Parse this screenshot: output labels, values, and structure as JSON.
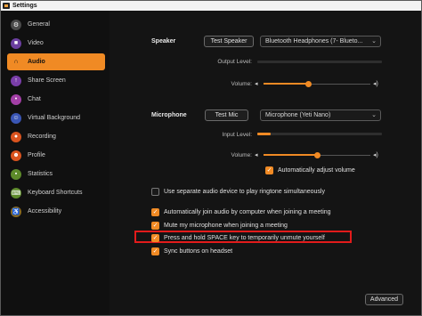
{
  "window": {
    "title": "Settings"
  },
  "sidebar": {
    "items": [
      {
        "label": "General",
        "icon": "gear-icon",
        "color": "#4a4a4a"
      },
      {
        "label": "Video",
        "icon": "camera-icon",
        "color": "#6b3fa0"
      },
      {
        "label": "Audio",
        "icon": "headphones-icon",
        "color": "#f08a24",
        "active": true
      },
      {
        "label": "Share Screen",
        "icon": "share-screen-icon",
        "color": "#7a3ea8"
      },
      {
        "label": "Chat",
        "icon": "chat-icon",
        "color": "#a33fa6"
      },
      {
        "label": "Virtual Background",
        "icon": "person-icon",
        "color": "#3a56b5"
      },
      {
        "label": "Recording",
        "icon": "record-icon",
        "color": "#d9531e"
      },
      {
        "label": "Profile",
        "icon": "profile-icon",
        "color": "#d9531e"
      },
      {
        "label": "Statistics",
        "icon": "statistics-icon",
        "color": "#5d8a2a"
      },
      {
        "label": "Keyboard Shortcuts",
        "icon": "keyboard-icon",
        "color": "#5d8a2a"
      },
      {
        "label": "Accessibility",
        "icon": "accessibility-icon",
        "color": "#8a6a20"
      }
    ]
  },
  "audio": {
    "speaker": {
      "label": "Speaker",
      "test_button": "Test Speaker",
      "device": "Bluetooth Headphones (7- Blueto...",
      "output_level_label": "Output Level:",
      "output_level": 0,
      "volume_label": "Volume:",
      "volume": 0.42
    },
    "microphone": {
      "label": "Microphone",
      "test_button": "Test Mic",
      "device": "Microphone (Yeti Nano)",
      "input_level_label": "Input Level:",
      "input_level": 0.11,
      "volume_label": "Volume:",
      "volume": 0.5
    },
    "auto_adjust": {
      "label": "Automatically adjust volume",
      "checked": true
    },
    "separate_device": {
      "label": "Use separate audio device to play ringtone simultaneously",
      "checked": false
    },
    "options": [
      {
        "label": "Automatically join audio by computer when joining a meeting",
        "checked": true
      },
      {
        "label": "Mute my microphone when joining a meeting",
        "checked": true
      },
      {
        "label": "Press and hold SPACE key to temporarily unmute yourself",
        "checked": true,
        "highlighted": true
      },
      {
        "label": "Sync buttons on headset",
        "checked": true
      }
    ],
    "advanced_button": "Advanced"
  },
  "colors": {
    "accent": "#f08a24",
    "highlight": "#e21b1b"
  }
}
